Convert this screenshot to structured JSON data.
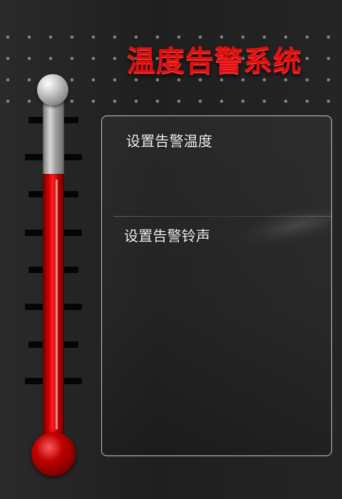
{
  "header": {
    "title": "温度告警系统"
  },
  "thermometer": {
    "fill_percent": 76
  },
  "settings": {
    "items": [
      {
        "label": "设置告警温度"
      },
      {
        "label": "设置告警铃声"
      }
    ]
  },
  "colors": {
    "title_red": "#e01010",
    "mercury_red": "#d80000",
    "panel_border": "#bdbdbd"
  }
}
